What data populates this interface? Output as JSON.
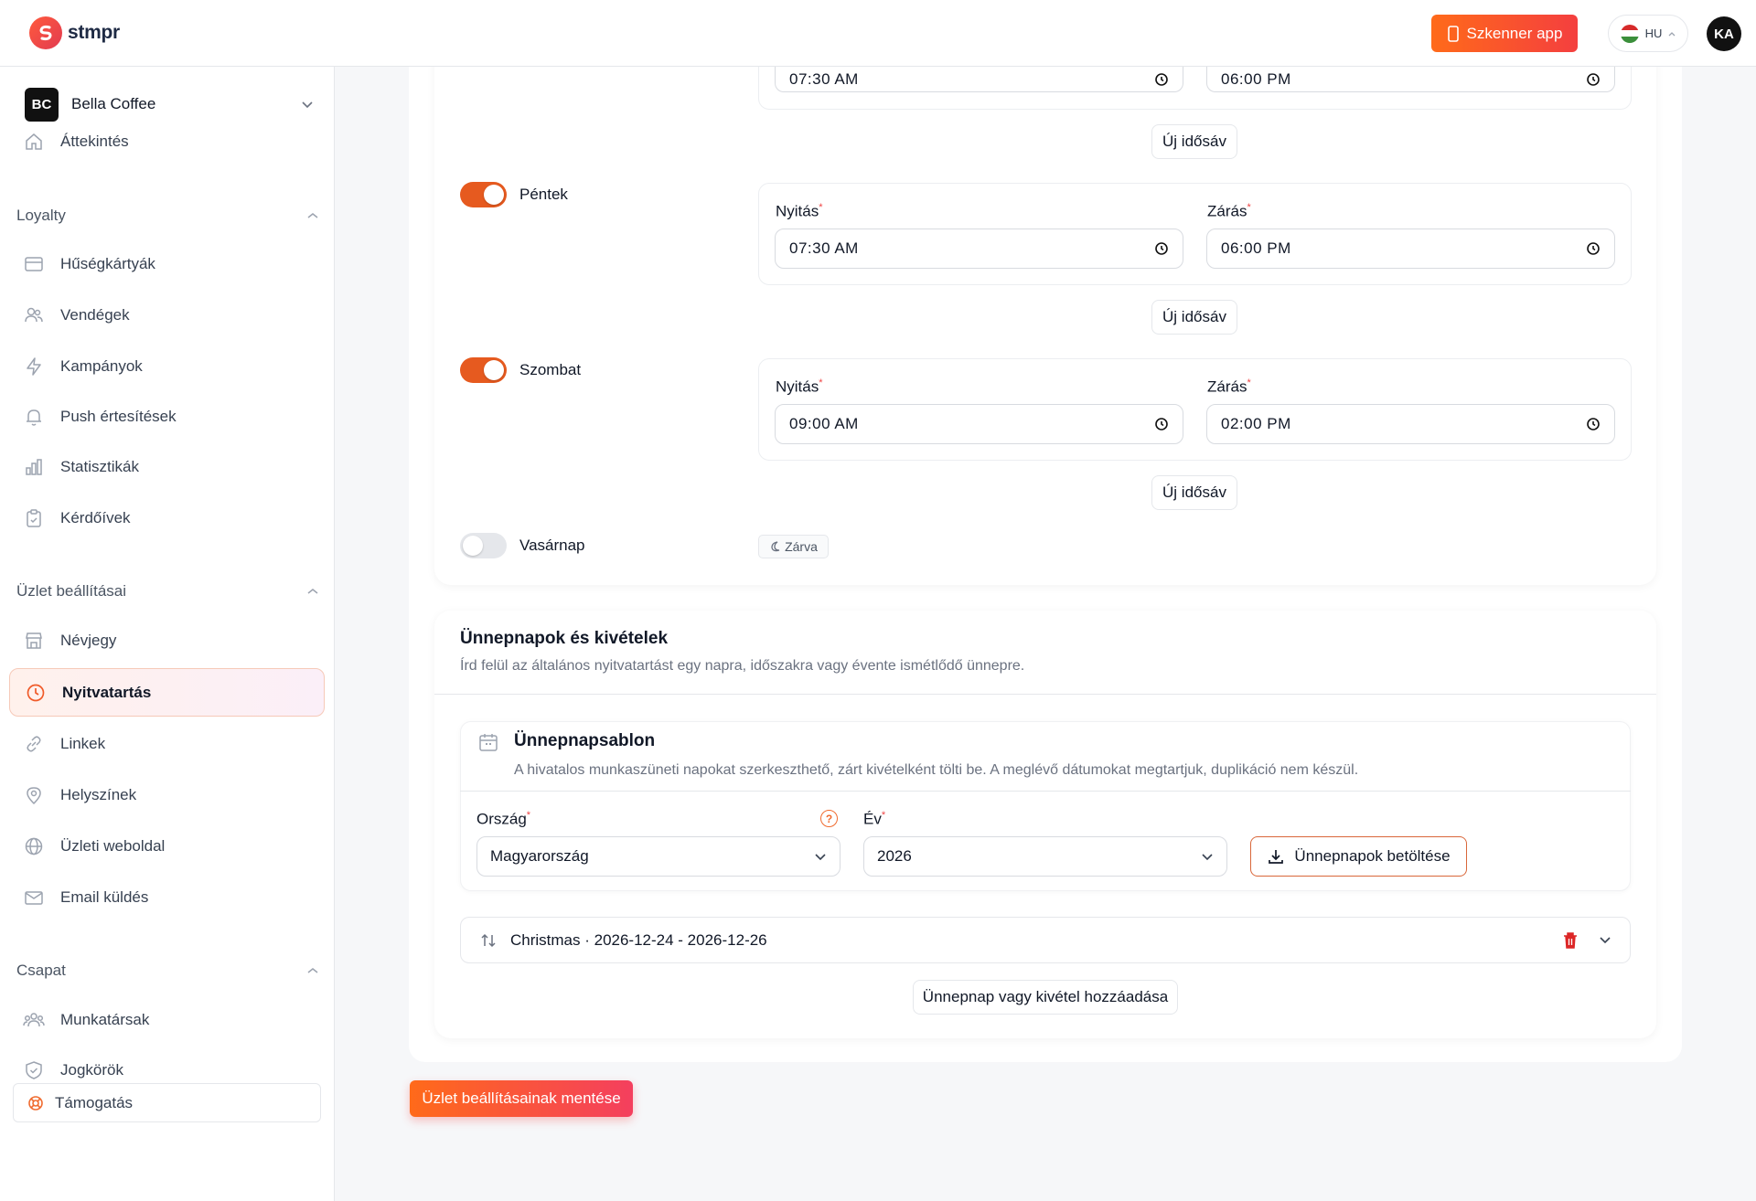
{
  "app": {
    "logo_text": "stmpr"
  },
  "topbar": {
    "scanner_label": "Szkenner app",
    "lang": "HU",
    "avatar": "KA"
  },
  "org": {
    "badge": "BC",
    "name": "Bella Coffee"
  },
  "sidebar": {
    "overview": "Áttekintés",
    "sections": [
      {
        "title": "Loyalty",
        "items": [
          "Hűségkártyák",
          "Vendégek",
          "Kampányok",
          "Push értesítések",
          "Statisztikák",
          "Kérdőívek"
        ]
      },
      {
        "title": "Üzlet beállításai",
        "items": [
          "Névjegy",
          "Nyitvatartás",
          "Linkek",
          "Helyszínek",
          "Üzleti weboldal",
          "Email küldés"
        ]
      },
      {
        "title": "Csapat",
        "items": [
          "Munkatársak",
          "Jogkörök"
        ]
      }
    ],
    "support": "Támogatás"
  },
  "hours": {
    "open_label": "Nyitás",
    "close_label": "Zárás",
    "new_slot": "Új idősáv",
    "closed": "Zárva",
    "partial": {
      "open": "07:30 AM",
      "close": "06:00 PM"
    },
    "days": [
      {
        "name": "Péntek",
        "enabled": true,
        "open": "07:30 AM",
        "close": "06:00 PM"
      },
      {
        "name": "Szombat",
        "enabled": true,
        "open": "09:00 AM",
        "close": "02:00 PM"
      },
      {
        "name": "Vasárnap",
        "enabled": false
      }
    ]
  },
  "holidays": {
    "title": "Ünnepnapok és kivételek",
    "subtitle": "Írd felül az általános nyitvatartást egy napra, időszakra vagy évente ismétlődő ünnepre.",
    "template": {
      "title": "Ünnepnapsablon",
      "subtitle": "A hivatalos munkaszüneti napokat szerkeszthető, zárt kivételként tölti be. A meglévő dátumokat megtartjuk, duplikáció nem készül.",
      "country_label": "Ország",
      "country_value": "Magyarország",
      "year_label": "Év",
      "year_value": "2026",
      "load_label": "Ünnepnapok betöltése"
    },
    "entry": "Christmas · 2026-12-24 - 2026-12-26",
    "add_label": "Ünnepnap vagy kivétel hozzáadása"
  },
  "save_label": "Üzlet beállításainak mentése",
  "colors": {
    "accent": "#e65a1f",
    "danger": "#dc2626"
  }
}
